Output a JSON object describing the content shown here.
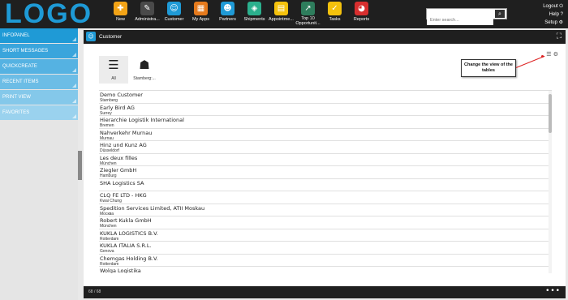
{
  "brand": {
    "logo": "LOGO"
  },
  "nav": [
    {
      "label": "New",
      "icon": "new-icon",
      "color": "#f2a316",
      "glyph": "✚"
    },
    {
      "label": "Administra...",
      "icon": "wrench-icon",
      "color": "#4a4a4a",
      "glyph": "✎"
    },
    {
      "label": "Customer",
      "icon": "customer-icon",
      "color": "#1f9ad6",
      "glyph": "☺"
    },
    {
      "label": "My Apps",
      "icon": "apps-icon",
      "color": "#e57a1d",
      "glyph": "▦"
    },
    {
      "label": "Partners",
      "icon": "partners-icon",
      "color": "#1f9ad6",
      "glyph": "☻"
    },
    {
      "label": "Shipments",
      "icon": "shipments-icon",
      "color": "#2bb08d",
      "glyph": "◈"
    },
    {
      "label": "Appointme...",
      "icon": "calendar-icon",
      "color": "#f4c20d",
      "glyph": "▤"
    },
    {
      "label": "Top 10 Opportunit...",
      "icon": "chart-icon",
      "color": "#2e7d5c",
      "glyph": "↗"
    },
    {
      "label": "Tasks",
      "icon": "tasks-icon",
      "color": "#f4c20d",
      "glyph": "✓"
    },
    {
      "label": "Reports",
      "icon": "reports-icon",
      "color": "#d72e2e",
      "glyph": "◕"
    }
  ],
  "search": {
    "placeholder": "Enter search..."
  },
  "toplinks": {
    "logout": "Logout",
    "help": "Help",
    "setup": "Setup"
  },
  "sidebar": {
    "items": [
      {
        "label": "INFOPANEL"
      },
      {
        "label": "SHORT MESSAGES"
      },
      {
        "label": "QUICKCREATE"
      },
      {
        "label": "RECENT ITEMS"
      },
      {
        "label": "PRINT VIEW"
      },
      {
        "label": "FAVORITES"
      }
    ]
  },
  "panel": {
    "title": "Customer",
    "views": [
      {
        "label": "All"
      },
      {
        "label": "Starnberg:..."
      }
    ],
    "callout": "Change the view of the tables",
    "rows": [
      {
        "name": "Demo Customer",
        "city": "Starnberg"
      },
      {
        "name": "Early Bird AG",
        "city": "Surrey"
      },
      {
        "name": "Hierarchie Logistik International",
        "city": "Bremen"
      },
      {
        "name": "Nahverkehr Murnau",
        "city": "Murnau"
      },
      {
        "name": "Hinz und Kunz AG",
        "city": "Düsseldorf"
      },
      {
        "name": "Les deux filles",
        "city": "München"
      },
      {
        "name": "Ziegler GmbH",
        "city": "Hamburg"
      },
      {
        "name": "SHA Logistics SA",
        "city": ""
      },
      {
        "name": "CLQ FE LTD - HKG",
        "city": "Kwai Chung"
      },
      {
        "name": "Spedition Services Limited, ATII Moskau",
        "city": "Moсква"
      },
      {
        "name": "Robert Kukla GmbH",
        "city": "München"
      },
      {
        "name": "KUKLA LOGISTICS B.V.",
        "city": "Rotterdam"
      },
      {
        "name": "KUKLA ITALIA S.R.L.",
        "city": "Genova"
      },
      {
        "name": "Chemgas Holding B.V.",
        "city": "Rotterdam"
      },
      {
        "name": "Wolga Logistika",
        "city": "Moskau"
      }
    ],
    "count": "68 / 68"
  }
}
